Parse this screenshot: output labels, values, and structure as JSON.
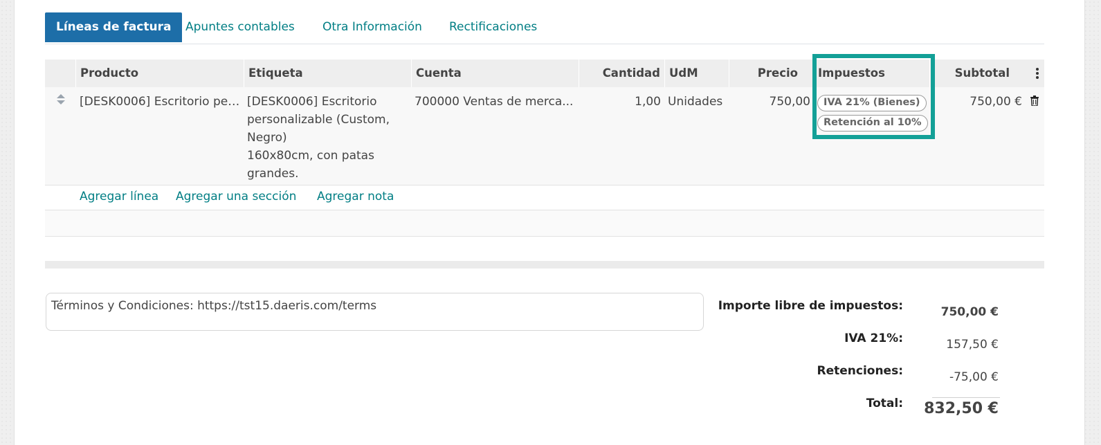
{
  "tabs": [
    {
      "label": "Líneas de factura",
      "active": true
    },
    {
      "label": "Apuntes contables",
      "active": false
    },
    {
      "label": "Otra Información",
      "active": false
    },
    {
      "label": "Rectificaciones",
      "active": false
    }
  ],
  "table": {
    "columns": [
      "Producto",
      "Etiqueta",
      "Cuenta",
      "Cantidad",
      "UdM",
      "Precio",
      "Impuestos",
      "Subtotal"
    ],
    "rows": [
      {
        "producto": "[DESK0006] Escritorio per...",
        "etiqueta": [
          "[DESK0006] Escritorio",
          "personalizable (Custom,",
          "Negro)",
          "160x80cm, con patas",
          "grandes."
        ],
        "cuenta": "700000 Ventas de merca...",
        "cantidad": "1,00",
        "udm": "Unidades",
        "precio": "750,00",
        "impuestos": [
          "IVA 21% (Bienes)",
          "Retención al 10%"
        ],
        "subtotal": "750,00 €"
      }
    ],
    "add_links": [
      "Agregar línea",
      "Agregar una sección",
      "Agregar nota"
    ]
  },
  "terms": "Términos y Condiciones: https://tst15.daeris.com/terms",
  "totals": {
    "untaxed_label": "Importe libre de impuestos:",
    "untaxed_value": "750,00 €",
    "iva_label": "IVA 21%:",
    "iva_value": "157,50 €",
    "retenciones_label": "Retenciones:",
    "retenciones_value": "-75,00 €",
    "total_label": "Total:",
    "total_value": "832,50 €"
  },
  "colors": {
    "highlight": "#13a097",
    "active_tab": "#1d6ea8",
    "link": "#017e84"
  }
}
